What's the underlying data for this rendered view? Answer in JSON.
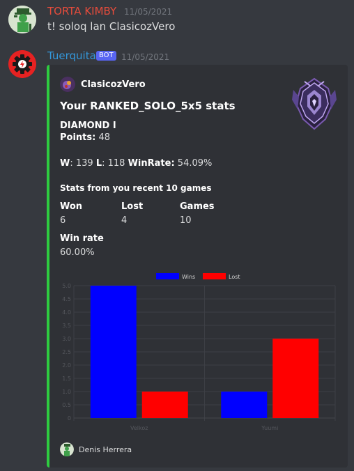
{
  "messages": [
    {
      "author": "TORTA KIMBY",
      "author_color": "#e74c3c",
      "timestamp": "11/05/2021",
      "content": "t! soloq lan ClasicozVero",
      "avatar_icon": "green-character-avatar"
    },
    {
      "author": "Tuerquita",
      "author_color": "#3498db",
      "badge": "BOT",
      "timestamp": "11/05/2021",
      "avatar_icon": "red-gear-avatar"
    }
  ],
  "embed": {
    "accent_color": "#2ecc40",
    "author_name": "ClasicozVero",
    "title": "Your RANKED_SOLO_5x5 stats",
    "rank": "DIAMOND I",
    "points_label": "Points:",
    "points_value": "48",
    "w_label": "W",
    "w_value": ": 139",
    "l_label": "L",
    "l_value": ": 118",
    "winrate_label": "WinRate:",
    "winrate_value": "54.09%",
    "recent_title": "Stats from you recent 10 games",
    "won_label": "Won",
    "won_value": "6",
    "lost_label": "Lost",
    "lost_value": "4",
    "games_label": "Games",
    "games_value": "10",
    "rate_label": "Win rate",
    "rate_value": "60.00%",
    "footer_text": "Denis Herrera",
    "thumbnail_icon": "diamond-rank-emblem"
  },
  "chart_data": {
    "type": "bar",
    "categories": [
      "Velkoz",
      "Yuumi"
    ],
    "series": [
      {
        "name": "Wins",
        "values": [
          5,
          1
        ],
        "color": "#0000ff"
      },
      {
        "name": "Lost",
        "values": [
          1,
          3
        ],
        "color": "#ff0000"
      }
    ],
    "ylim": [
      0,
      5
    ],
    "yticks": [
      "0",
      "0.5",
      "1.0",
      "1.5",
      "2.0",
      "2.5",
      "3.0",
      "3.5",
      "4.0",
      "4.5",
      "5.0"
    ],
    "legend_position": "top",
    "grid": true
  }
}
